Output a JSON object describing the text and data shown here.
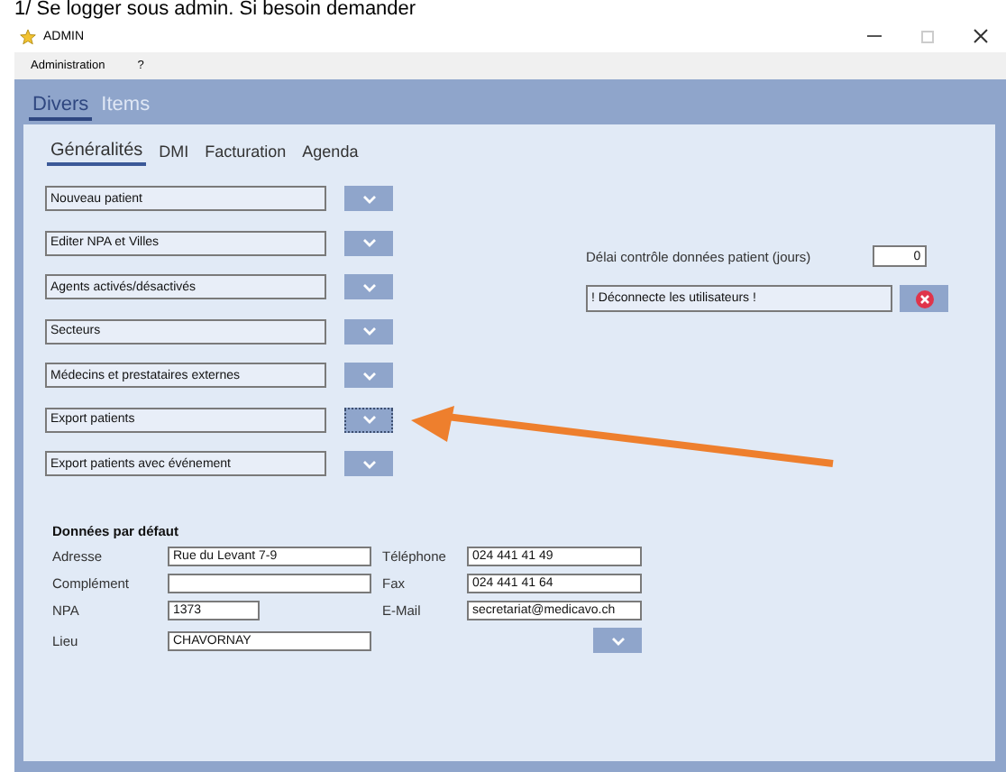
{
  "caption": "1/ Se logger sous admin. Si besoin demander",
  "window": {
    "title": "ADMIN"
  },
  "menu": [
    "Administration",
    "?"
  ],
  "tabs": [
    {
      "label": "Divers",
      "selected": true
    },
    {
      "label": "Items",
      "selected": false
    }
  ],
  "subtabs": [
    {
      "label": "Généralités",
      "selected": true
    },
    {
      "label": "DMI",
      "selected": false
    },
    {
      "label": "Facturation",
      "selected": false
    },
    {
      "label": "Agenda",
      "selected": false
    }
  ],
  "actions": [
    {
      "label": "Nouveau patient",
      "focused": false
    },
    {
      "label": "Editer NPA et Villes",
      "focused": false
    },
    {
      "label": "Agents activés/désactivés",
      "focused": false
    },
    {
      "label": "Secteurs",
      "focused": false
    },
    {
      "label": "Médecins et prestataires externes",
      "focused": false
    },
    {
      "label": "Export patients",
      "focused": true
    },
    {
      "label": "Export patients avec événement",
      "focused": false
    }
  ],
  "delay": {
    "label": "Délai contrôle données patient (jours)",
    "value": "0"
  },
  "disconnect": {
    "label": "! Déconnecte les utilisateurs !"
  },
  "defaults": {
    "title": "Données par défaut",
    "left_fields": [
      {
        "label": "Adresse",
        "value": "Rue du Levant 7-9"
      },
      {
        "label": "Complément"
      },
      {
        "label": "NPA",
        "value": "1373"
      },
      {
        "label": "Lieu",
        "value": "CHAVORNAY"
      }
    ],
    "right_fields": [
      {
        "label": "Téléphone",
        "value": "024 441 41 49"
      },
      {
        "label": "Fax",
        "value": "024 441 41 64"
      },
      {
        "label": "E-Mail",
        "value": "secretariat@medicavo.ch"
      }
    ]
  }
}
